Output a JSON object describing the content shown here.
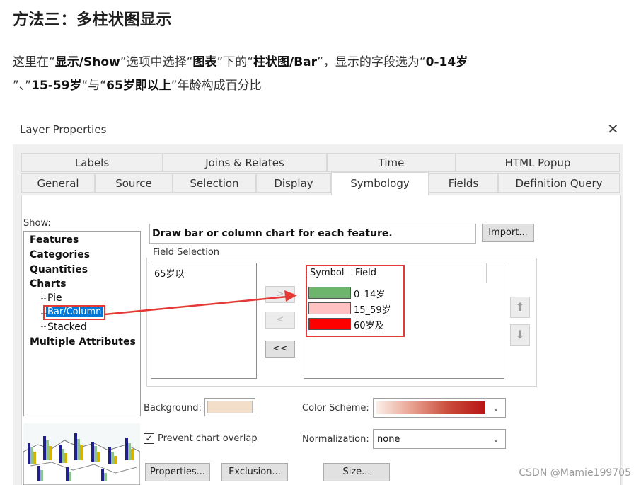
{
  "article": {
    "title": "方法三：多柱状图显示",
    "p1": "这里在“",
    "b1": "显示/Show",
    "p2": "”选项中选择“",
    "b2": "图表",
    "p3": "”下的“",
    "b3": "柱状图/Bar",
    "p4": "”，显示的字段选为“",
    "b4": "0-14岁",
    "p5": "”、”",
    "b5": "15-59岁",
    "p6": "“与“",
    "b6": "65岁即以上",
    "p7": "”年龄构成百分比"
  },
  "dialog": {
    "title": "Layer Properties",
    "close_icon": "close-icon",
    "tabs_row1": [
      "Labels",
      "Joins & Relates",
      "Time",
      "HTML Popup"
    ],
    "tabs_row2": [
      "General",
      "Source",
      "Selection",
      "Display",
      "Symbology",
      "Fields",
      "Definition Query"
    ],
    "active_tab": "Symbology"
  },
  "symbology": {
    "show_label": "Show:",
    "tree": {
      "features": "Features",
      "categories": "Categories",
      "quantities": "Quantities",
      "charts": "Charts",
      "pie": "Pie",
      "bar": "Bar/Column",
      "stacked": "Stacked",
      "multiple": "Multiple Attributes"
    },
    "description": "Draw bar or column chart for each feature.",
    "import_label": "Import...",
    "field_selection_label": "Field Selection",
    "available_fields": [
      "65岁以"
    ],
    "symbol_header": "Symbol",
    "field_header": "Field",
    "selected_fields": [
      {
        "name": "0_14岁",
        "color": "#6db56d"
      },
      {
        "name": "15_59岁",
        "color": "#ffc1c1"
      },
      {
        "name": "60岁及",
        "color": "#ff0000"
      }
    ],
    "move_right_label": ">",
    "move_left_label": "<",
    "move_all_left_label": "<<",
    "background_label": "Background:",
    "background_color": "#f3dfc9",
    "color_scheme_label": "Color Scheme:",
    "prevent_overlap_label": "Prevent chart overlap",
    "prevent_overlap_checked": true,
    "normalization_label": "Normalization:",
    "normalization_value": "none",
    "properties_label": "Properties...",
    "exclusion_label": "Exclusion...",
    "size_label": "Size...",
    "up_icon": "arrow-up-icon",
    "down_icon": "arrow-down-icon"
  },
  "annotation": {
    "highlight_color": "#e53935"
  },
  "watermark": "CSDN @Mamie199705"
}
